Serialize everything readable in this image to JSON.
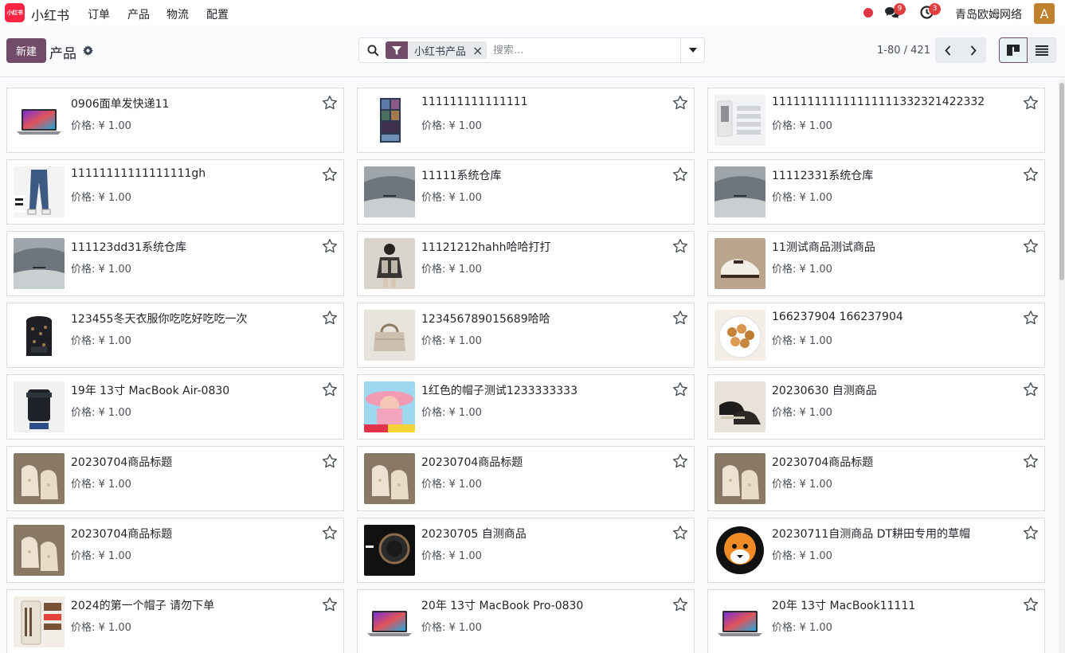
{
  "nav": {
    "logo_text": "小红书",
    "app_name": "小红书",
    "menu": [
      "订单",
      "产品",
      "物流",
      "配置"
    ],
    "messages_count": "9",
    "activities_count": "3",
    "company": "青岛欧姆网络",
    "avatar_letter": "A",
    "colors": {
      "brand": "#ff2442",
      "status_dot": "#dc3545",
      "avatar": "#c0812f"
    }
  },
  "control_panel": {
    "new_label": "新建",
    "breadcrumb": "产品",
    "search": {
      "facet": "小红书产品",
      "placeholder": "搜索..."
    },
    "pager": "1-80 / 421",
    "accent": "#714b67"
  },
  "products": [
    {
      "name": "0906面单发快递11",
      "price": "价格: ¥ 1.00",
      "thumb": "laptop"
    },
    {
      "name": "111111111111111",
      "price": "价格: ¥ 1.00",
      "thumb": "poster"
    },
    {
      "name": "111111111111111111332321422332",
      "price": "价格: ¥ 1.00",
      "thumb": "cosmetic"
    },
    {
      "name": "11111111111111111gh",
      "price": "价格: ¥ 1.00",
      "thumb": "jeans"
    },
    {
      "name": "11111系统仓库",
      "price": "价格: ¥ 1.00",
      "thumb": "fabric"
    },
    {
      "name": "11112331系统仓库",
      "price": "价格: ¥ 1.00",
      "thumb": "fabric"
    },
    {
      "name": "111123dd31系统仓库",
      "price": "价格: ¥ 1.00",
      "thumb": "fabric"
    },
    {
      "name": "11121212hahh哈哈打打",
      "price": "价格: ¥ 1.00",
      "thumb": "person"
    },
    {
      "name": "11测试商品测试商品",
      "price": "价格: ¥ 1.00",
      "thumb": "shoe"
    },
    {
      "name": "123455冬天衣服你吃吃好吃吃一次",
      "price": "价格: ¥ 1.00",
      "thumb": "backpack"
    },
    {
      "name": "123456789015689哈哈",
      "price": "价格: ¥ 1.00",
      "thumb": "bag"
    },
    {
      "name": "166237904 166237904",
      "price": "价格: ¥ 1.00",
      "thumb": "nuts"
    },
    {
      "name": "19年 13寸 MacBook Air-0830",
      "price": "价格: ¥ 1.00",
      "thumb": "lens"
    },
    {
      "name": "1红色的帽子测试1233333333",
      "price": "价格: ¥ 1.00",
      "thumb": "hat"
    },
    {
      "name": "20230630 自测商品",
      "price": "价格: ¥ 1.00",
      "thumb": "loafer"
    },
    {
      "name": "20230704商品标题",
      "price": "价格: ¥ 1.00",
      "thumb": "slipper"
    },
    {
      "name": "20230704商品标题",
      "price": "价格: ¥ 1.00",
      "thumb": "slipper"
    },
    {
      "name": "20230704商品标题",
      "price": "价格: ¥ 1.00",
      "thumb": "slipper"
    },
    {
      "name": "20230704商品标题",
      "price": "价格: ¥ 1.00",
      "thumb": "slipper"
    },
    {
      "name": "20230705 自测商品",
      "price": "价格: ¥ 1.00",
      "thumb": "watch"
    },
    {
      "name": "20230711自测商品 DT耕田专用的草帽",
      "price": "价格: ¥ 1.00",
      "thumb": "tiger"
    },
    {
      "name": "2024的第一个帽子 请勿下单",
      "price": "价格: ¥ 1.00",
      "thumb": "box"
    },
    {
      "name": "20年 13寸 MacBook Pro-0830",
      "price": "价格: ¥ 1.00",
      "thumb": "laptop"
    },
    {
      "name": "20年 13寸 MacBook11111",
      "price": "价格: ¥ 1.00",
      "thumb": "laptop"
    }
  ]
}
